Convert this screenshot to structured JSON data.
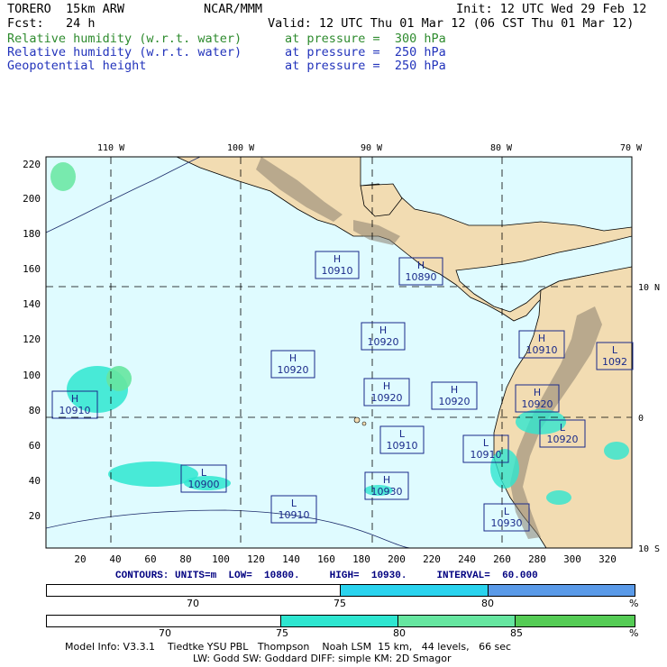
{
  "header": {
    "model": "TORERO  15km ARW",
    "org": "NCAR/MMM",
    "init": "Init: 12 UTC Wed 29 Feb 12",
    "fcst": "Fcst:   24 h",
    "valid": "Valid: 12 UTC Thu 01 Mar 12 (06 CST Thu 01 Mar 12)",
    "fields": [
      {
        "name": "Relative humidity (w.r.t. water)",
        "level": "at pressure =  300 hPa",
        "color": "#2e8b2e"
      },
      {
        "name": "Relative humidity (w.r.t. water)",
        "level": "at pressure =  250 hPa",
        "color": "#2233bb"
      },
      {
        "name": "Geopotential height",
        "level": "at pressure =  250 hPa",
        "color": "#2233bb"
      }
    ]
  },
  "map": {
    "top_lon_labels": [
      "110 W",
      "100 W",
      "90 W",
      "80 W",
      "70 W"
    ],
    "right_lat_labels": [
      "10 N",
      "0",
      "10 S"
    ],
    "left_ticks": [
      "220",
      "200",
      "180",
      "160",
      "140",
      "120",
      "100",
      "80",
      "60",
      "40",
      "20"
    ],
    "bottom_ticks": [
      "20",
      "40",
      "60",
      "80",
      "100",
      "120",
      "140",
      "160",
      "180",
      "200",
      "220",
      "240",
      "260",
      "280",
      "300",
      "320"
    ],
    "highs_lows": [
      {
        "type": "H",
        "value": "10910"
      },
      {
        "type": "H",
        "value": "10890"
      },
      {
        "type": "H",
        "value": "10920"
      },
      {
        "type": "H",
        "value": "10920"
      },
      {
        "type": "H",
        "value": "10920"
      },
      {
        "type": "H",
        "value": "10920"
      },
      {
        "type": "H",
        "value": "10910"
      },
      {
        "type": "H",
        "value": "10910"
      },
      {
        "type": "H",
        "value": "10920"
      },
      {
        "type": "L",
        "value": "10920"
      },
      {
        "type": "L",
        "value": "1092"
      },
      {
        "type": "L",
        "value": "10910"
      },
      {
        "type": "L",
        "value": "10910"
      },
      {
        "type": "L",
        "value": "10900"
      },
      {
        "type": "H",
        "value": "10930"
      },
      {
        "type": "L",
        "value": "10910"
      },
      {
        "type": "L",
        "value": "10930"
      }
    ],
    "colors": {
      "ocean": "#dffbff",
      "land": "#f2dcb2",
      "terrain": "#8a7f70"
    }
  },
  "contours_line": "CONTOURS: UNITS=m  LOW=  10800.     HIGH=  10930.     INTERVAL=  60.000",
  "colorbar_blue": {
    "labels": [
      "70",
      "75",
      "80",
      "%"
    ],
    "colors": [
      "#ffffff",
      "#2ad3ee",
      "#5a9ae8"
    ]
  },
  "colorbar_green": {
    "labels": [
      "70",
      "75",
      "80",
      "85",
      "%"
    ],
    "colors": [
      "#ffffff",
      "#2ee6d0",
      "#66e6a0",
      "#55cc55"
    ]
  },
  "footer": {
    "line1": "Model Info: V3.3.1    Tiedtke YSU PBL   Thompson    Noah LSM  15 km,   44 levels,   66 sec",
    "line2": "LW: Godd SW: Goddard DIFF: simple KM: 2D Smagor"
  }
}
